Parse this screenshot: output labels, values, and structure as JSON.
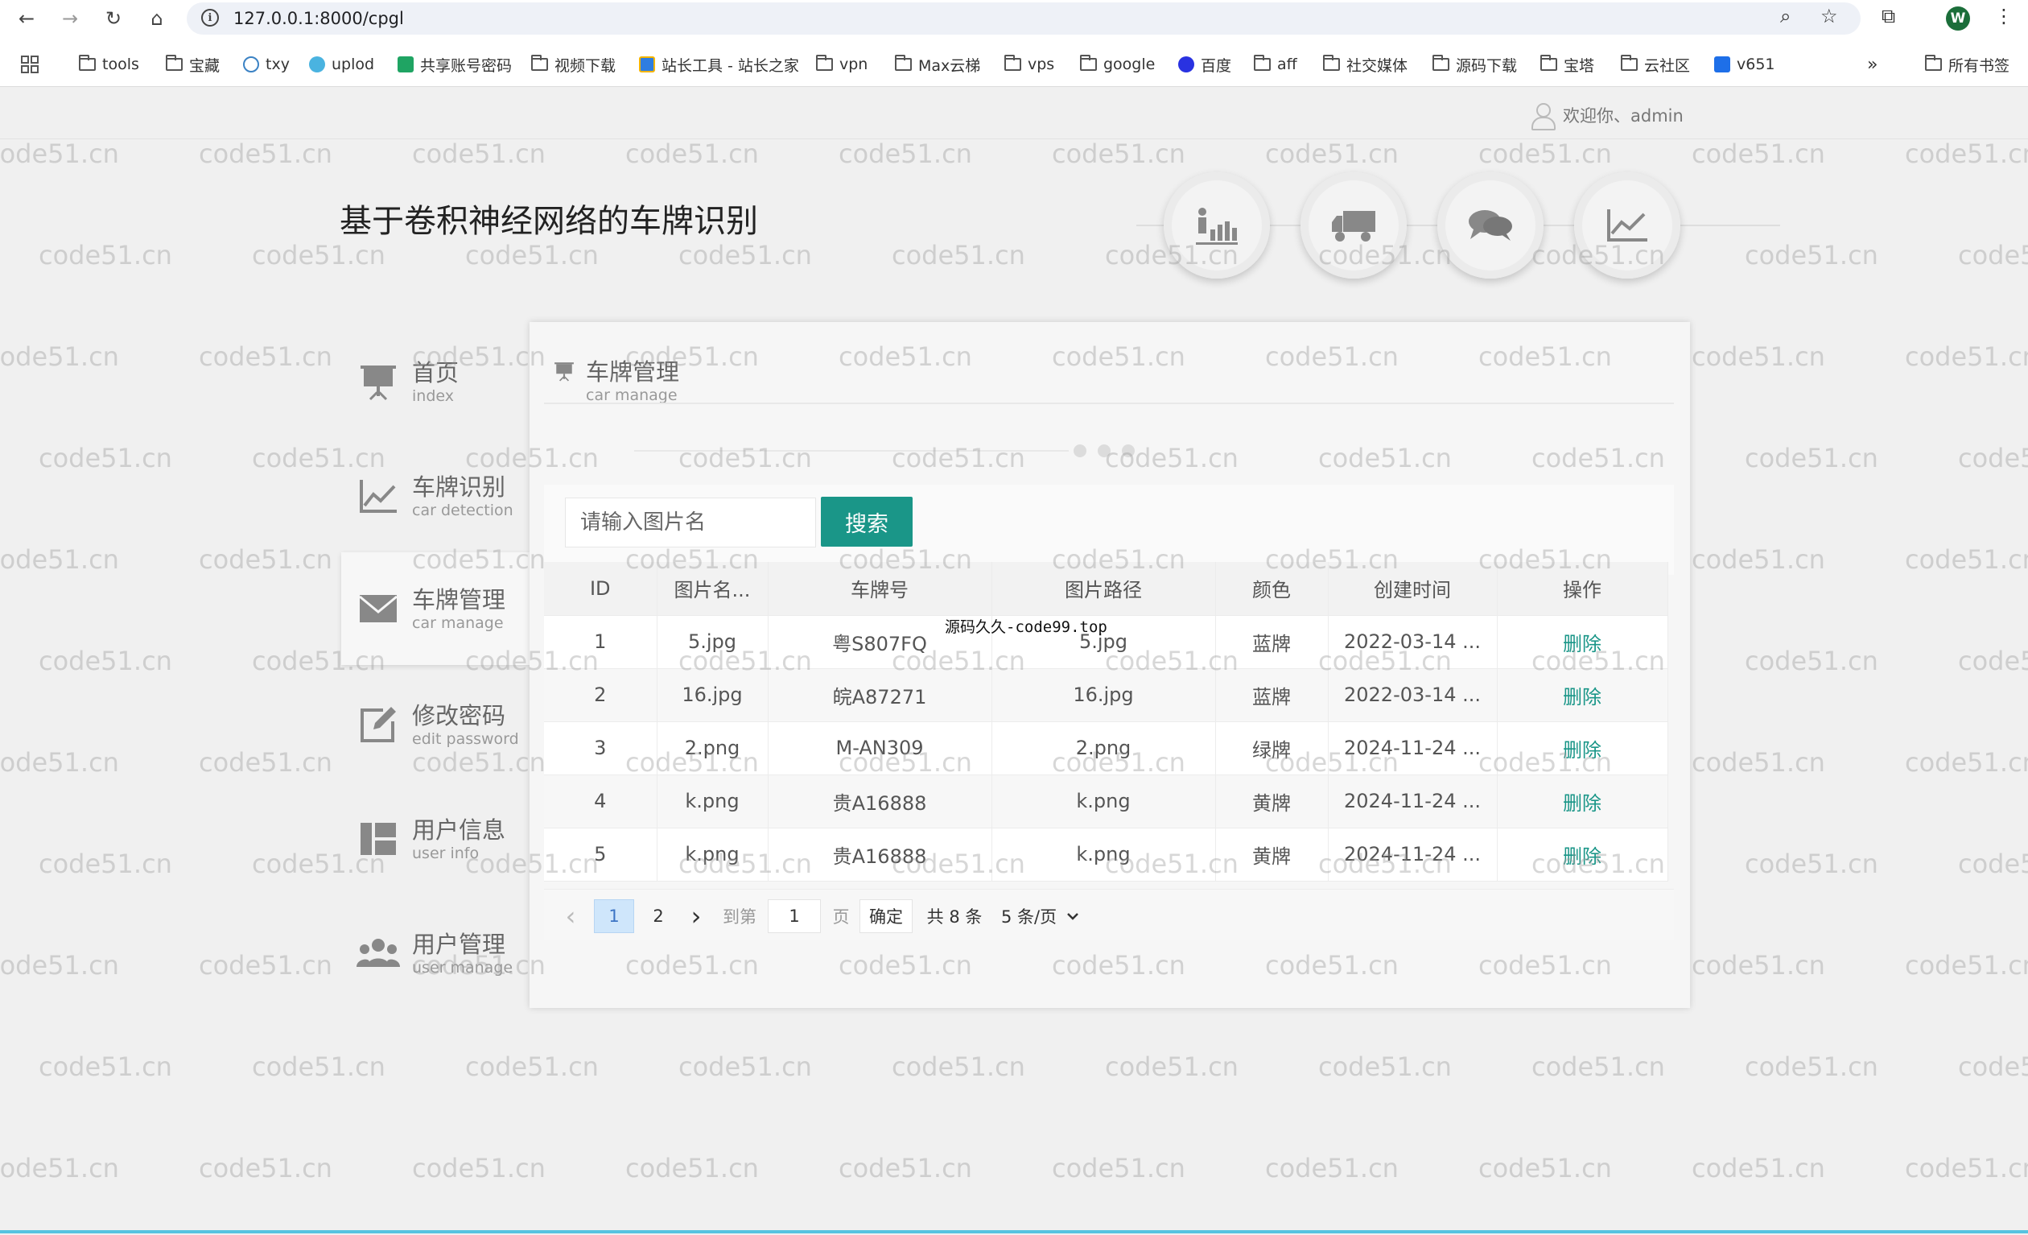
{
  "browser": {
    "url": "127.0.0.1:8000/cpgl",
    "profile_initial": "W",
    "bookmarks": [
      "tools",
      "宝藏",
      "txy",
      "uplod",
      "共享账号密码",
      "视频下载",
      "站长工具 - 站长之家",
      "vpn",
      "Max云梯",
      "vps",
      "google",
      "百度",
      "aff",
      "社交媒体",
      "源码下载",
      "宝塔",
      "云社区",
      "v651"
    ],
    "bookmarks_more": "»",
    "all_bookmarks": "所有书签"
  },
  "header": {
    "welcome": "欢迎你、admin",
    "site_title": "基于卷积神经网络的车牌识别"
  },
  "circles": [
    "people-chart-icon",
    "truck-icon",
    "chat-icon",
    "line-chart-icon"
  ],
  "sidebar": {
    "items": [
      {
        "zh": "首页",
        "en": "index",
        "icon": "presentation-icon"
      },
      {
        "zh": "车牌识别",
        "en": "car detection",
        "icon": "line-chart-icon"
      },
      {
        "zh": "车牌管理",
        "en": "car manage",
        "icon": "mail-icon"
      },
      {
        "zh": "修改密码",
        "en": "edit password",
        "icon": "edit-icon"
      },
      {
        "zh": "用户信息",
        "en": "user info",
        "icon": "grid-icon"
      },
      {
        "zh": "用户管理",
        "en": "user manage",
        "icon": "users-icon"
      }
    ]
  },
  "panel": {
    "title_zh": "车牌管理",
    "title_en": "car manage",
    "search_placeholder": "请输入图片名",
    "search_button": "搜索",
    "columns": [
      "ID",
      "图片名...",
      "车牌号",
      "图片路径",
      "颜色",
      "创建时间",
      "操作"
    ],
    "rows": [
      {
        "id": "1",
        "name": "5.jpg",
        "plate": "粤S807FQ",
        "path": "5.jpg",
        "color": "蓝牌",
        "time": "2022-03-14 ...",
        "action": "删除"
      },
      {
        "id": "2",
        "name": "16.jpg",
        "plate": "皖A87271",
        "path": "16.jpg",
        "color": "蓝牌",
        "time": "2022-03-14 ...",
        "action": "删除"
      },
      {
        "id": "3",
        "name": "2.png",
        "plate": "M-AN309",
        "path": "2.png",
        "color": "绿牌",
        "time": "2024-11-24 ...",
        "action": "删除"
      },
      {
        "id": "4",
        "name": "k.png",
        "plate": "贵A16888",
        "path": "k.png",
        "color": "黄牌",
        "time": "2024-11-24 ...",
        "action": "删除"
      },
      {
        "id": "5",
        "name": "k.png",
        "plate": "贵A16888",
        "path": "k.png",
        "color": "黄牌",
        "time": "2024-11-24 ...",
        "action": "删除"
      }
    ],
    "pager": {
      "prev": "‹",
      "pages": [
        "1",
        "2"
      ],
      "current": "1",
      "next": "›",
      "goto_label": "到第",
      "goto_value": "1",
      "page_label": "页",
      "confirm": "确定",
      "total": "共 8 条",
      "page_size": "5 条/页"
    }
  },
  "overlay_text": "源码久久-code99.top",
  "watermark": "code51.cn",
  "colors": {
    "accent": "#1a9688",
    "page_bg": "#f0f0f0"
  }
}
